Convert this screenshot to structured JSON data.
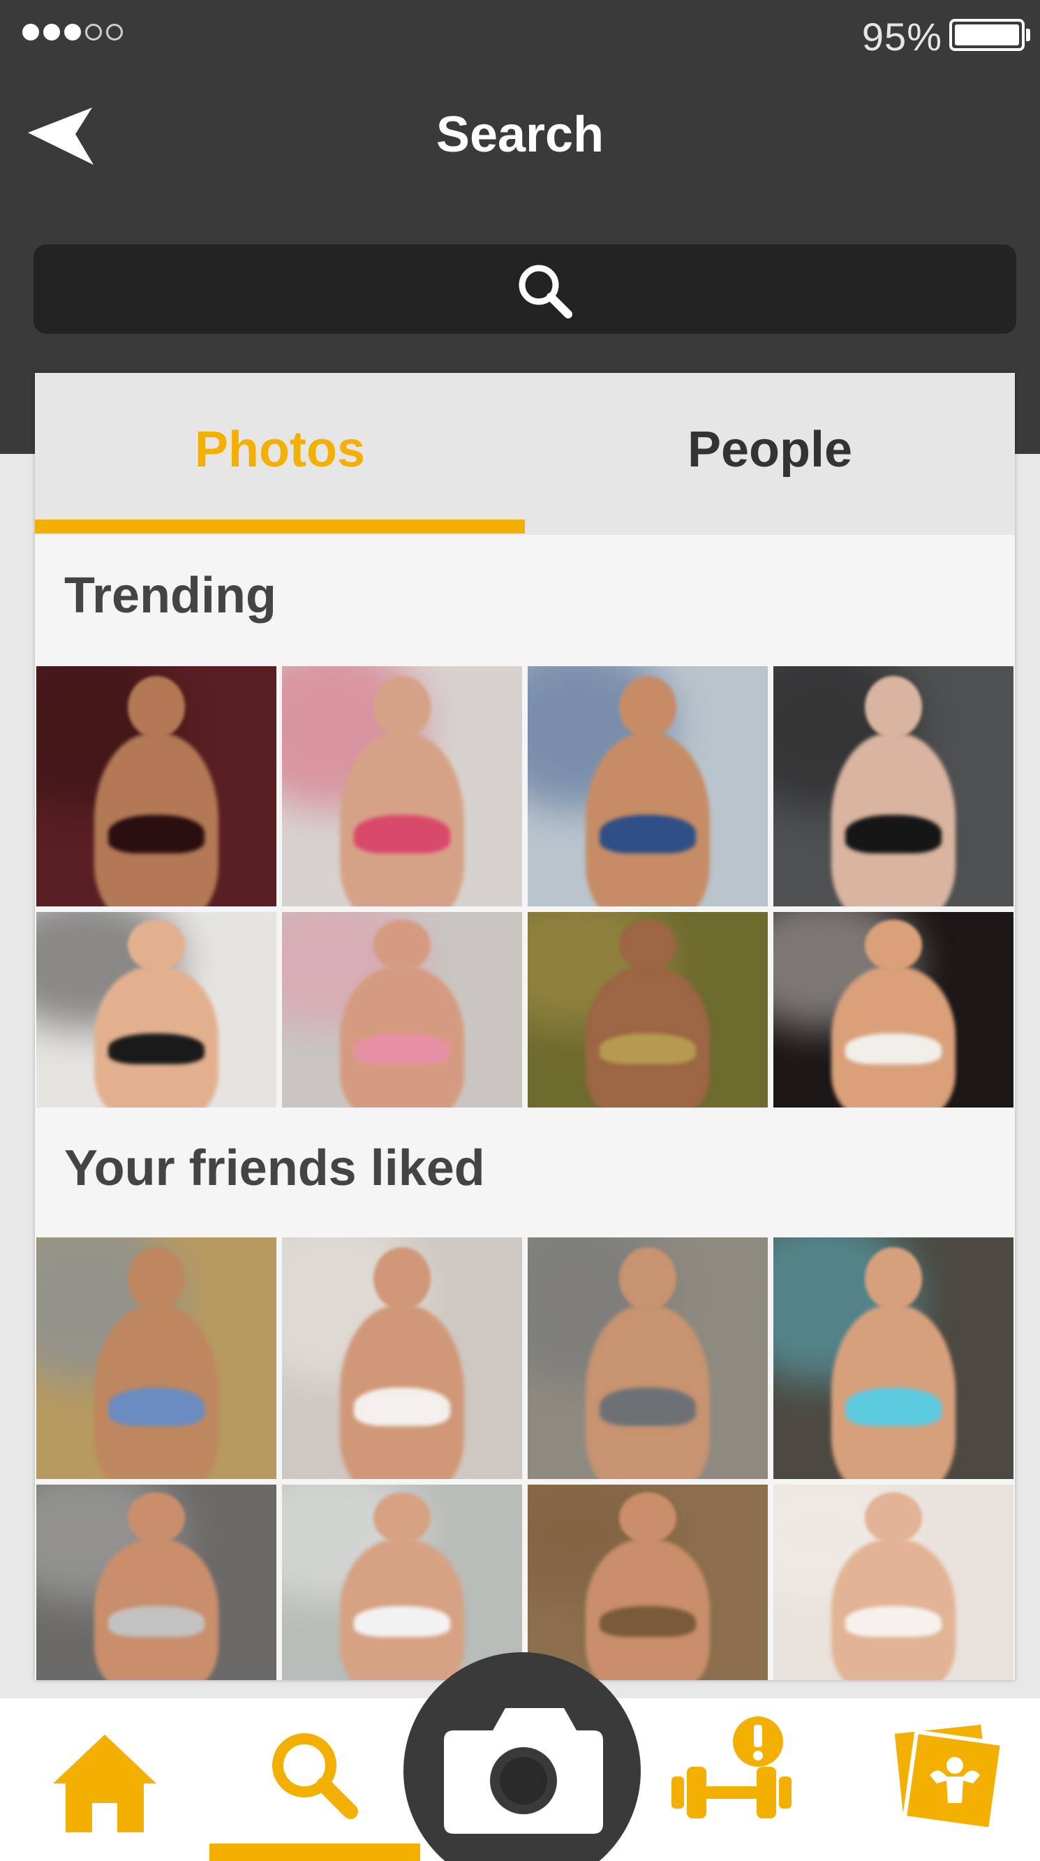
{
  "status_bar": {
    "signal_bars_filled": 3,
    "signal_bars_total": 5,
    "battery_percent": "95%",
    "battery_icon": "battery-icon"
  },
  "header": {
    "title": "Search",
    "back_icon": "back-arrow-icon"
  },
  "search": {
    "icon": "search-icon",
    "placeholder": ""
  },
  "tabs": [
    {
      "label": "Photos",
      "selected": true
    },
    {
      "label": "People",
      "selected": false
    }
  ],
  "sections": {
    "trending": {
      "title": "Trending",
      "photos": [
        {
          "name": "trending-photo-1",
          "bg": "#5a1f22",
          "skin": "#b37955",
          "accent": "#2a0e10"
        },
        {
          "name": "trending-photo-2",
          "bg": "#d7d2cf",
          "skin": "#d6a287",
          "accent": "#d94a6a"
        },
        {
          "name": "trending-photo-3",
          "bg": "#b9c4cc",
          "skin": "#c68c66",
          "accent": "#2f4f86"
        },
        {
          "name": "trending-photo-4",
          "bg": "#4f5052",
          "skin": "#d9b4a0",
          "accent": "#161616"
        },
        {
          "name": "trending-photo-5",
          "bg": "#e6e4e1",
          "skin": "#e2b08f",
          "accent": "#1a1a1a"
        },
        {
          "name": "trending-photo-6",
          "bg": "#c9c6c2",
          "skin": "#d59b80",
          "accent": "#e78fa4"
        },
        {
          "name": "trending-photo-7",
          "bg": "#6e6b2e",
          "skin": "#9c6544",
          "accent": "#b79a52"
        },
        {
          "name": "trending-photo-8",
          "bg": "#1b1716",
          "skin": "#d9a07a",
          "accent": "#f1efea"
        }
      ]
    },
    "friends_liked": {
      "title": "Your friends liked",
      "photos": [
        {
          "name": "friends-photo-1",
          "bg": "#b79a60",
          "skin": "#bf875f",
          "accent": "#6a8cc0"
        },
        {
          "name": "friends-photo-2",
          "bg": "#cfc7c1",
          "skin": "#d09878",
          "accent": "#f3f0ec"
        },
        {
          "name": "friends-photo-3",
          "bg": "#8e8a80",
          "skin": "#c79370",
          "accent": "#6d7176"
        },
        {
          "name": "friends-photo-4",
          "bg": "#4c4942",
          "skin": "#d7a07c",
          "accent": "#5ccbe0"
        },
        {
          "name": "friends-photo-5",
          "bg": "#6b6a68",
          "skin": "#c98f6c",
          "accent": "#c2c2c2"
        },
        {
          "name": "friends-photo-6",
          "bg": "#b8bcb8",
          "skin": "#d6a283",
          "accent": "#f2f2f2"
        },
        {
          "name": "friends-photo-7",
          "bg": "#8c6f4e",
          "skin": "#c98f6a",
          "accent": "#7a5a3a"
        },
        {
          "name": "friends-photo-8",
          "bg": "#e9e2dc",
          "skin": "#e2b394",
          "accent": "#f6f1ec"
        }
      ]
    }
  },
  "bottom_nav": {
    "items": [
      {
        "icon": "home-icon",
        "active": false
      },
      {
        "icon": "search-icon",
        "active": true
      },
      {
        "icon": "camera-icon",
        "active": false
      },
      {
        "icon": "workout-alert-icon",
        "active": false
      },
      {
        "icon": "fitness-card-icon",
        "active": false
      }
    ]
  },
  "colors": {
    "accent": "#f4b000",
    "header_bg": "#3a3a3a",
    "search_bg": "#232323",
    "tab_bg": "#e6e6e6",
    "card_bg": "#f5f5f5"
  }
}
